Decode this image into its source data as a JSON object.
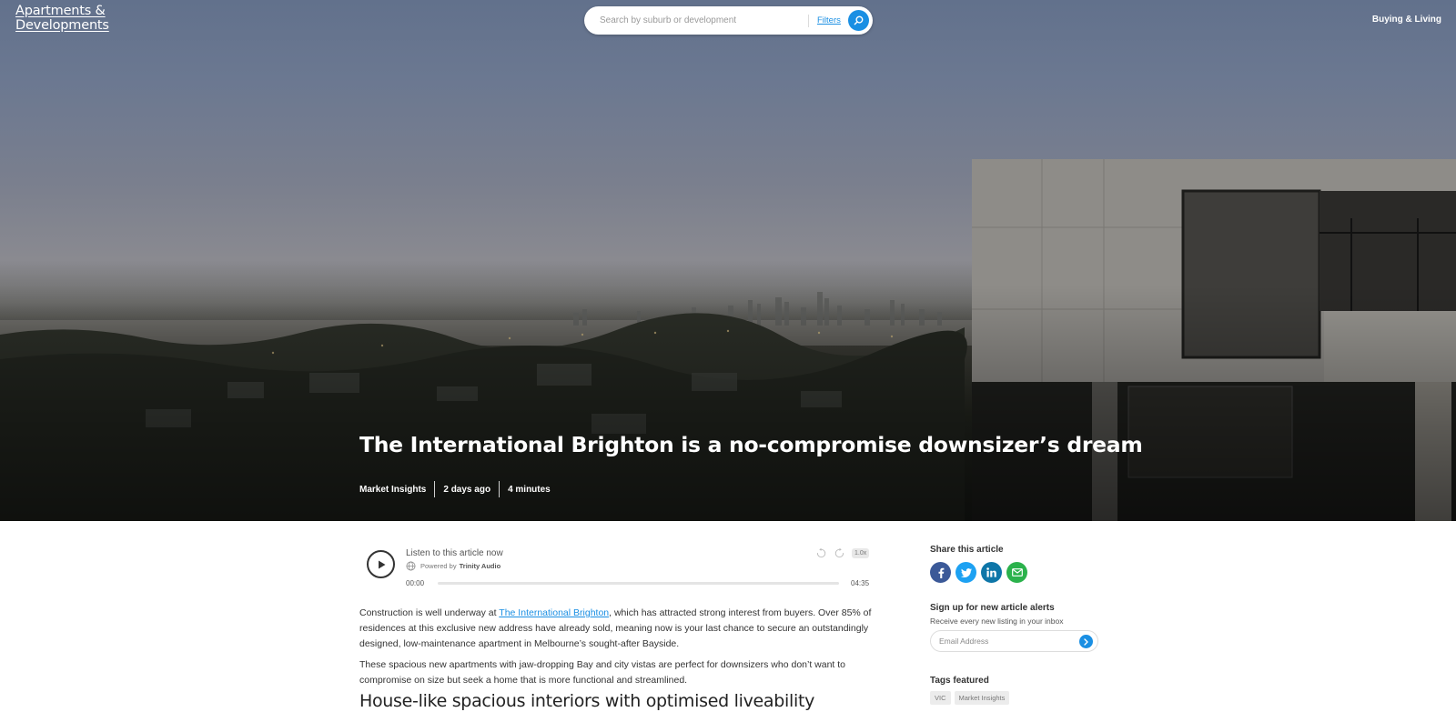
{
  "header": {
    "logo_line1": "Apartments &",
    "logo_line2": "Developments",
    "search_placeholder": "Search by suburb or development",
    "filters_label": "Filters",
    "nav_right": "Buying & Living"
  },
  "hero": {
    "title": "The International Brighton is a no-compromise downsizer’s dream",
    "category": "Market Insights",
    "date": "2 days ago",
    "read_time": "4 minutes"
  },
  "player": {
    "listen_label": "Listen to this article now",
    "powered_by": "Powered by",
    "provider": "Trinity Audio",
    "current_time": "00:00",
    "total_time": "04:35",
    "speed": "1.0x",
    "progress": 0
  },
  "article": {
    "p1_before": "Construction is well underway at ",
    "p1_link": "The International Brighton",
    "p1_after": ", which has attracted strong interest from buyers. Over 85% of residences at this exclusive new address have already sold, meaning now is your last chance to secure an outstandingly designed, low-maintenance apartment in Melbourne’s sought-after Bayside.",
    "p2": "These spacious new apartments with jaw-dropping Bay and city vistas are perfect for downsizers who don’t want to compromise on size but seek a home that is more functional and streamlined.",
    "h2": "House-like spacious interiors with optimised liveability"
  },
  "sidebar": {
    "share_heading": "Share this article",
    "share_icons": [
      "facebook-icon",
      "twitter-icon",
      "linkedin-icon",
      "email-icon"
    ],
    "alerts_heading": "Sign up for new article alerts",
    "alerts_sub": "Receive every new listing in your inbox",
    "email_placeholder": "Email Address",
    "tags_heading": "Tags featured",
    "tags": [
      "VIC",
      "Market Insights"
    ]
  },
  "colors": {
    "accent": "#1a8fe3",
    "facebook": "#3b5998",
    "twitter": "#1da1f2",
    "linkedin": "#0e76a8",
    "email": "#2bb24c"
  }
}
